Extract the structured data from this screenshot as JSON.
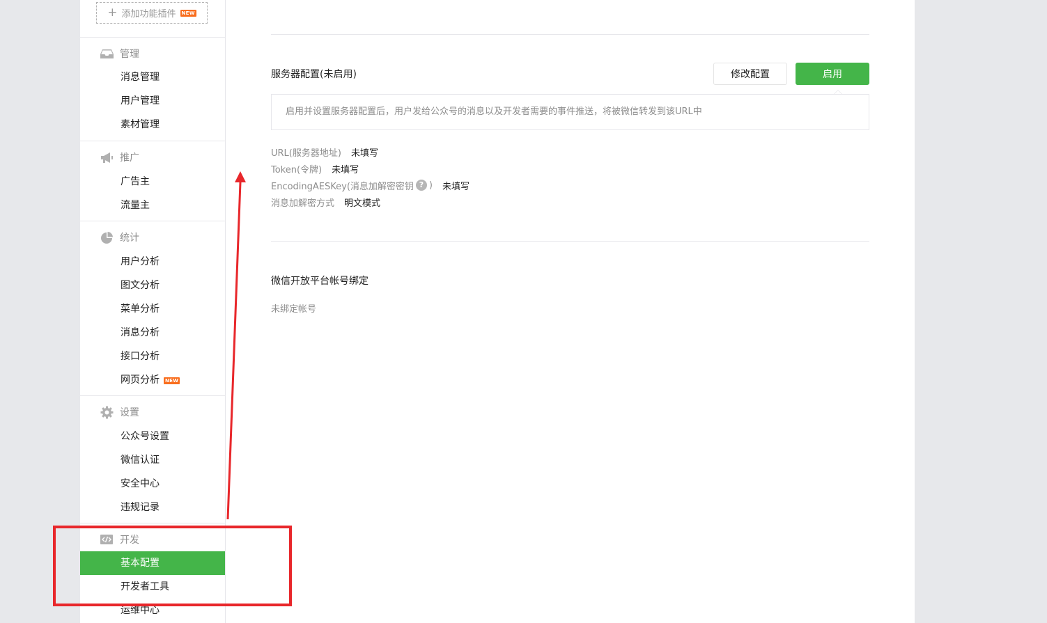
{
  "sidebar": {
    "add_plugin": {
      "label": "添加功能插件",
      "badge": "NEW"
    },
    "groups": [
      {
        "title": "管理",
        "icon": "inbox-icon",
        "items": [
          {
            "label": "消息管理"
          },
          {
            "label": "用户管理"
          },
          {
            "label": "素材管理"
          }
        ]
      },
      {
        "title": "推广",
        "icon": "megaphone-icon",
        "items": [
          {
            "label": "广告主"
          },
          {
            "label": "流量主"
          }
        ]
      },
      {
        "title": "统计",
        "icon": "pie-chart-icon",
        "items": [
          {
            "label": "用户分析"
          },
          {
            "label": "图文分析"
          },
          {
            "label": "菜单分析"
          },
          {
            "label": "消息分析"
          },
          {
            "label": "接口分析"
          },
          {
            "label": "网页分析",
            "badge": "NEW"
          }
        ]
      },
      {
        "title": "设置",
        "icon": "gear-icon",
        "items": [
          {
            "label": "公众号设置"
          },
          {
            "label": "微信认证"
          },
          {
            "label": "安全中心"
          },
          {
            "label": "违规记录"
          }
        ]
      },
      {
        "title": "开发",
        "icon": "code-icon",
        "items": [
          {
            "label": "基本配置",
            "active": true
          },
          {
            "label": "开发者工具"
          },
          {
            "label": "运维中心"
          }
        ]
      }
    ]
  },
  "server_config": {
    "title": "服务器配置(未启用)",
    "modify_button": "修改配置",
    "enable_button": "启用",
    "tip": "启用并设置服务器配置后，用户发给公众号的消息以及开发者需要的事件推送，将被微信转发到该URL中",
    "fields": [
      {
        "label": "URL(服务器地址)",
        "value": "未填写"
      },
      {
        "label": "Token(令牌)",
        "value": "未填写"
      },
      {
        "label": "EncodingAESKey(消息加解密密钥",
        "label_suffix": ")",
        "help": "?",
        "value": "未填写"
      },
      {
        "label": "消息加解密方式",
        "value": "明文模式"
      }
    ]
  },
  "open_platform": {
    "title": "微信开放平台帐号绑定",
    "status": "未绑定帐号"
  },
  "colors": {
    "brand_green": "#44b549",
    "annotation_red": "#e8272b",
    "new_badge": "#f96e1e"
  }
}
